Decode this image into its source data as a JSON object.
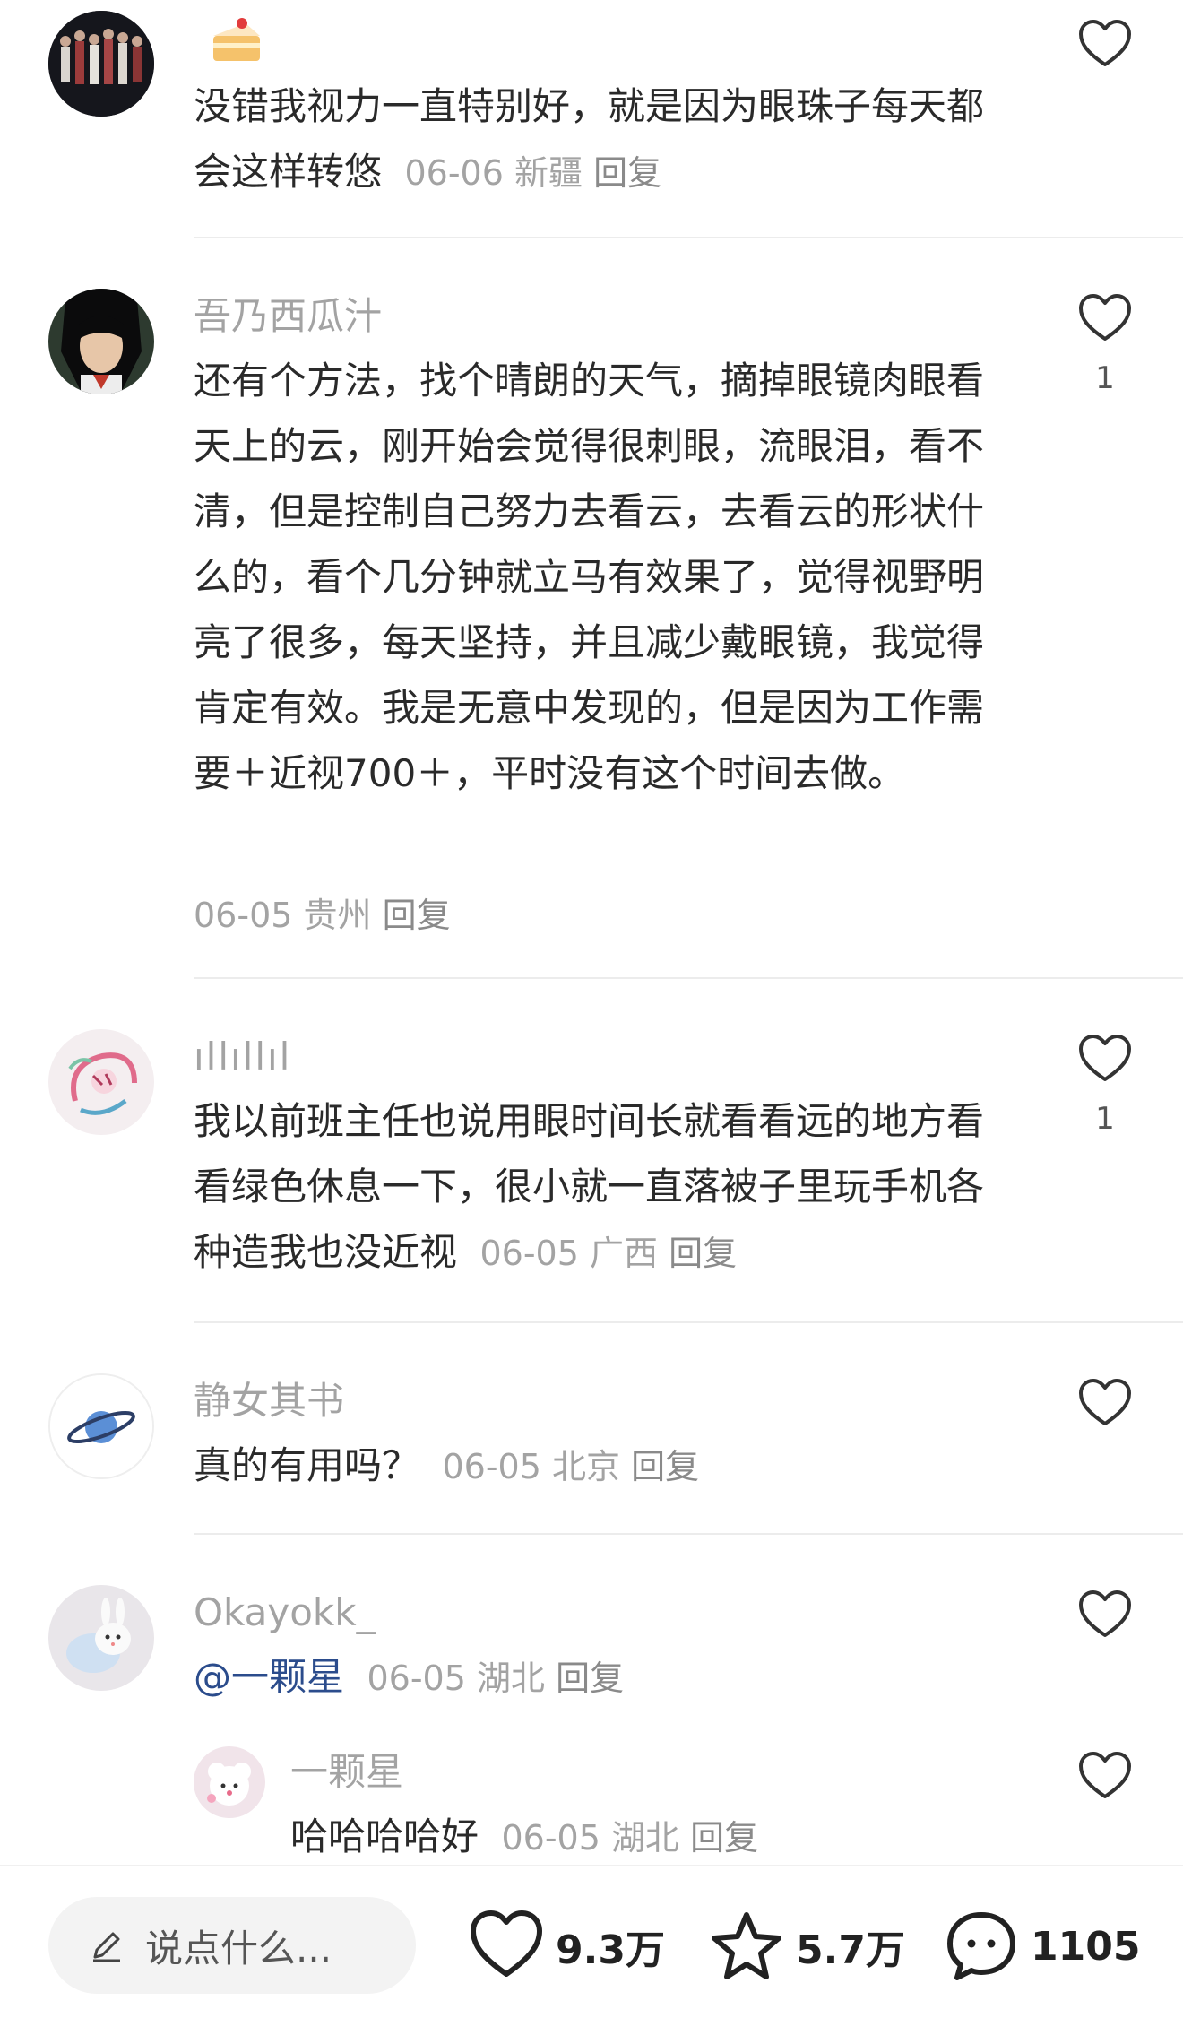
{
  "comments": [
    {
      "username": "",
      "text": "没错我视力一直特别好，就是因为眼珠子每天都会这样转悠",
      "date": "06-06",
      "location": "新疆",
      "reply": "回复",
      "likes": ""
    },
    {
      "username": "吾乃西瓜汁",
      "text": "还有个方法，找个晴朗的天气，摘掉眼镜肉眼看天上的云，刚开始会觉得很刺眼，流眼泪，看不清，但是控制自己努力去看云，去看云的形状什么的，看个几分钟就立马有效果了，觉得视野明亮了很多，每天坚持，并且减少戴眼镜，我觉得肯定有效。我是无意中发现的，但是因为工作需要＋近视700＋，平时没有这个时间去做。",
      "date": "06-05",
      "location": "贵州",
      "reply": "回复",
      "likes": "1"
    },
    {
      "username": "ıllıllıl",
      "text": "我以前班主任也说用眼时间长就看看远的地方看看绿色休息一下，很小就一直落被子里玩手机各种造我也没近视",
      "date": "06-05",
      "location": "广西",
      "reply": "回复",
      "likes": "1"
    },
    {
      "username": "静女其书",
      "text": "真的有用吗？",
      "date": "06-05",
      "location": "北京",
      "reply": "回复",
      "likes": ""
    },
    {
      "username": "Okayokk_",
      "mention": "@一颗星",
      "date": "06-05",
      "location": "湖北",
      "reply": "回复",
      "likes": ""
    },
    {
      "username": "一颗星",
      "text": "哈哈哈哈好",
      "date": "06-05",
      "location": "湖北",
      "reply": "回复",
      "likes": ""
    }
  ],
  "bottom_bar": {
    "input_placeholder": "说点什么...",
    "likes": "9.3万",
    "favorites": "5.7万",
    "comments": "1105"
  },
  "icons": {
    "like": "heart-outline-icon",
    "favorite": "star-outline-icon",
    "comment": "chat-bubble-icon",
    "edit": "pencil-icon",
    "cake": "cake-emoji-icon"
  }
}
